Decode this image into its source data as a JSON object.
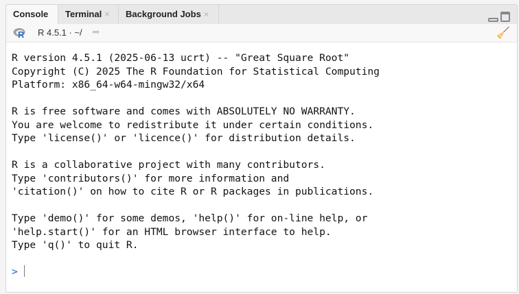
{
  "tabs": [
    {
      "label": "Console",
      "closable": false
    },
    {
      "label": "Terminal",
      "closable": true
    },
    {
      "label": "Background Jobs",
      "closable": true
    }
  ],
  "toolbar": {
    "r_version": "R 4.5.1 · ~/",
    "close_glyph": "×"
  },
  "console": {
    "lines": [
      "R version 4.5.1 (2025-06-13 ucrt) -- \"Great Square Root\"",
      "Copyright (C) 2025 The R Foundation for Statistical Computing",
      "Platform: x86_64-w64-mingw32/x64",
      "",
      "R is free software and comes with ABSOLUTELY NO WARRANTY.",
      "You are welcome to redistribute it under certain conditions.",
      "Type 'license()' or 'licence()' for distribution details.",
      "",
      "R is a collaborative project with many contributors.",
      "Type 'contributors()' for more information and",
      "'citation()' on how to cite R or R packages in publications.",
      "",
      "Type 'demo()' for some demos, 'help()' for on-line help, or",
      "'help.start()' for an HTML browser interface to help.",
      "Type 'q()' to quit R.",
      ""
    ],
    "prompt": ">"
  },
  "colors": {
    "prompt": "#1f5fbf",
    "r_logo": "#2a6ebb"
  }
}
